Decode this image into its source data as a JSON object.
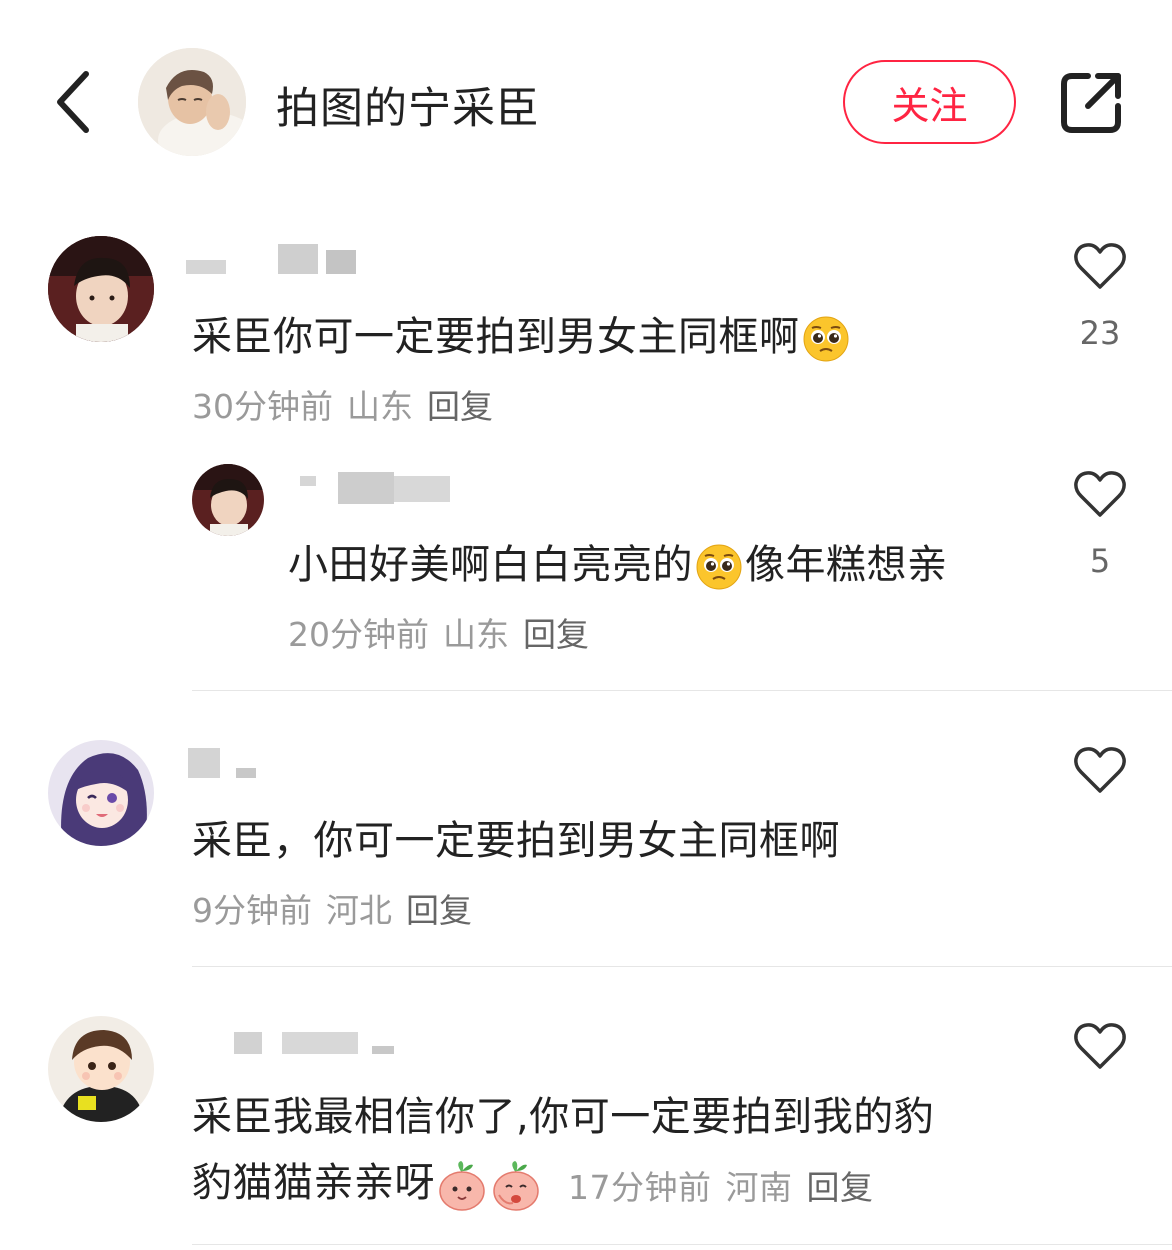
{
  "header": {
    "author_name": "拍图的宁采臣",
    "follow_label": "关注"
  },
  "comments": [
    {
      "text": "采臣你可一定要拍到男女主同框啊",
      "emoji": "pleading-face-emoji",
      "time": "30分钟前",
      "location": "山东",
      "reply": "回复",
      "likes": "23"
    },
    {
      "text": "小田好美啊白白亮亮的",
      "emoji": "pleading-face-emoji",
      "text_after": "像年糕想亲",
      "time": "20分钟前",
      "location": "山东",
      "reply": "回复",
      "likes": "5"
    },
    {
      "text": "采臣，你可一定要拍到男女主同框啊",
      "time": "9分钟前",
      "location": "河北",
      "reply": "回复",
      "likes": ""
    },
    {
      "text_line1": "采臣我最相信你了,你可一定要拍到我的豹",
      "text_line2": "豹猫猫亲亲呀",
      "emoji": "peach-face-emoji",
      "time": "17分钟前",
      "location": "河南",
      "reply": "回复",
      "likes": ""
    }
  ],
  "colors": {
    "accent": "#ff2442",
    "meta_text": "#9a9a9a",
    "body_text": "#222222"
  }
}
